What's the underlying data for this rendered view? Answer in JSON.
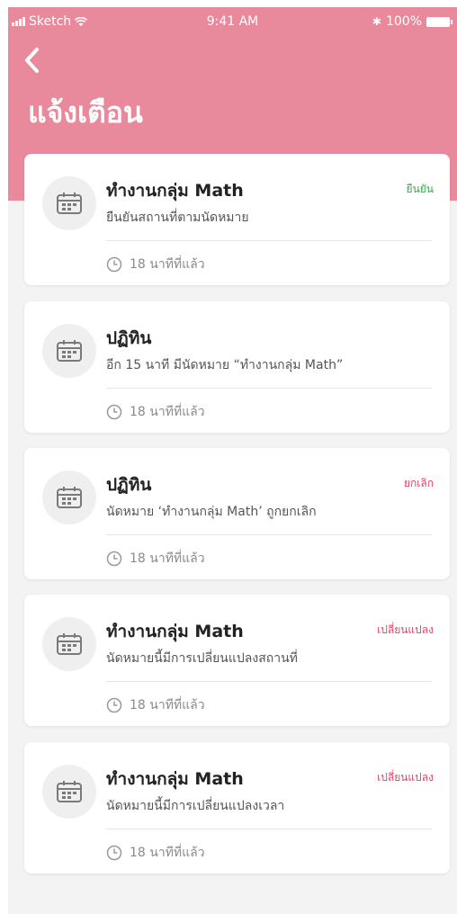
{
  "status_bar": {
    "carrier": "Sketch",
    "time": "9:41 AM",
    "battery": "100%"
  },
  "header": {
    "title": "แจ้งเตือน"
  },
  "notifications": [
    {
      "title": "ทำงานกลุ่ม Math",
      "description": "ยืนยันสถานที่ตามนัดหมาย",
      "status": "ยืนยัน",
      "time": "18 นาทีที่แล้ว",
      "status_color": "#3aa64a"
    },
    {
      "title": "ปฏิทิน",
      "description": "อีก 15 นาที มีนัดหมาย “ทำงานกลุ่ม Math”",
      "status": "",
      "time": "18 นาทีที่แล้ว",
      "status_color": "#e0456a"
    },
    {
      "title": "ปฏิทิน",
      "description": "นัดหมาย ‘ทำงานกลุ่ม Math’ ถูกยกเลิก",
      "status": "ยกเลิก",
      "time": "18 นาทีที่แล้ว",
      "status_color": "#e0456a"
    },
    {
      "title": "ทำงานกลุ่ม Math",
      "description": "นัดหมายนี้มีการเปลี่ยนแปลงสถานที่",
      "status": "เปลี่ยนแปลง",
      "time": "18 นาทีที่แล้ว",
      "status_color": "#e0456a"
    },
    {
      "title": "ทำงานกลุ่ม Math",
      "description": "นัดหมายนี้มีการเปลี่ยนแปลงเวลา",
      "status": "เปลี่ยนแปลง",
      "time": "18 นาทีที่แล้ว",
      "status_color": "#e0456a"
    }
  ]
}
